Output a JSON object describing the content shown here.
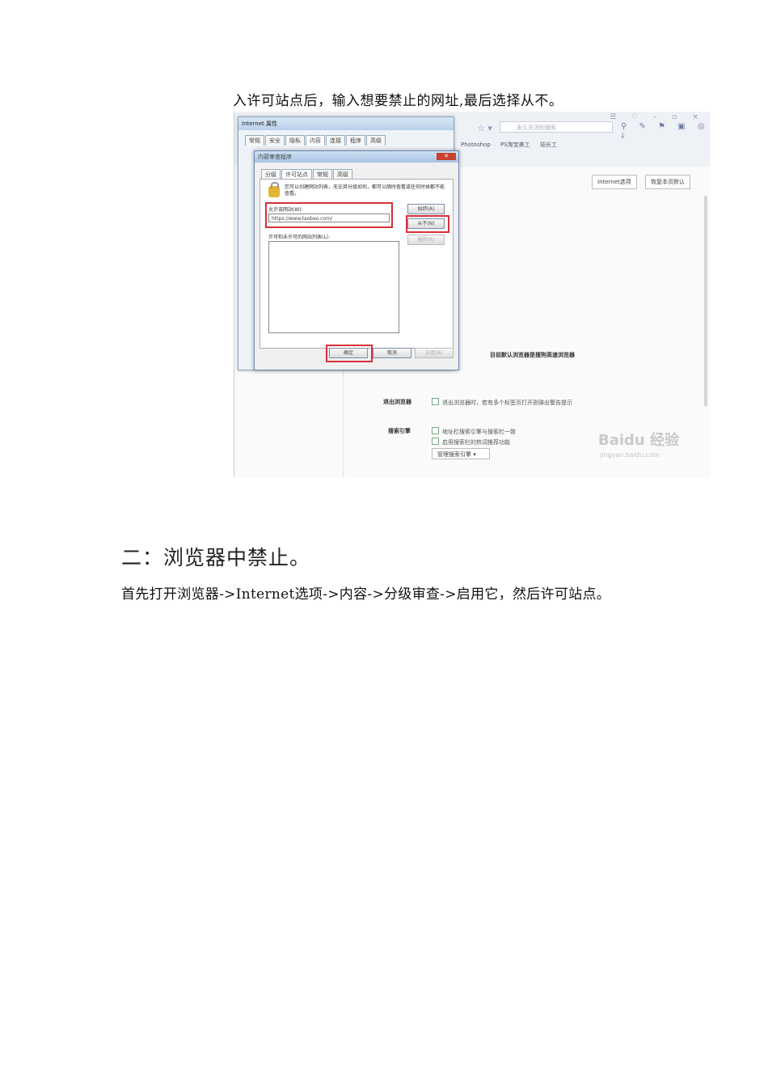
{
  "doc": {
    "caption": "入许可站点后，输入想要禁止的网址,最后选择从不。",
    "heading": "二：浏览器中禁止。",
    "paragraph": "首先打开浏览器->Internet选项->内容->分级审查->启用它，然后许可站点。"
  },
  "screenshot": {
    "browser": {
      "window_controls": "☰ ♡ – ▫ ×",
      "star": "☆ ▾",
      "search_placeholder": "永久关闭的搜索",
      "toolbar_icons": "⚲ ✎ ⚑ ▣ ◎ ⤓",
      "favorites": [
        "Photoshop",
        "PS淘宝美工",
        "站长工"
      ],
      "settings_buttons": [
        "Internet选项",
        "恢复本页默认"
      ],
      "settings_rows": [
        {
          "label": "退出浏览器",
          "option": "退出浏览器时，若有多个标签页打开则弹出警告提示"
        },
        {
          "label": "搜索引擎",
          "option": "地址栏搜索引擎与搜索栏一致"
        },
        {
          "label": "",
          "option": "启用搜索栏的热词推荐功能"
        }
      ],
      "default_browser_text": "目前默认浏览器是搜狗高速浏览器",
      "search_engine_select": "管理搜索引擎 ▾",
      "watermark": "Baidu 经验",
      "watermark_url": "jingyan.baidu.com"
    },
    "back_dialog": {
      "title": "Internet 属性",
      "tabs": [
        "常规",
        "安全",
        "隐私",
        "内容",
        "连接",
        "程序",
        "高级"
      ]
    },
    "dialog": {
      "title": "内容审查程序",
      "close": "✕",
      "tabs": [
        "分级",
        "许可站点",
        "常规",
        "高级"
      ],
      "info": "您可以创建网站列表，无论其分级如何，都可以随时查看或任何时候都不能查看。",
      "allow_label": "允许该网站(W):",
      "url_value": "https://www.taobao.com/",
      "always_button": "始终(A)",
      "never_button": "从不(N)",
      "remove_button": "删除(R)",
      "list_label": "许可和未许可的网站列表(L):",
      "ok_button": "确定",
      "cancel_button": "取消",
      "apply_button": "应用(A)"
    }
  }
}
